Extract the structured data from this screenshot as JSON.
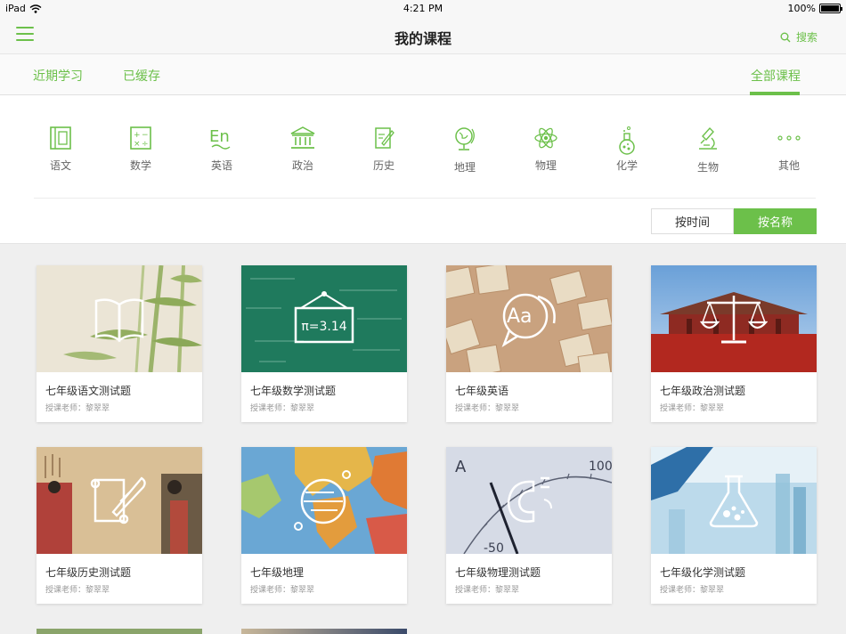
{
  "status": {
    "device": "iPad",
    "time": "4:21 PM",
    "battery": "100%",
    "battery_level": 1.0
  },
  "nav": {
    "title": "我的课程",
    "search_label": "搜索"
  },
  "tabs": {
    "recent": "近期学习",
    "cached": "已缓存",
    "all": "全部课程"
  },
  "subjects": [
    "语文",
    "数学",
    "英语",
    "政治",
    "历史",
    "地理",
    "物理",
    "化学",
    "生物",
    "其他"
  ],
  "sort": {
    "by_time": "按时间",
    "by_name": "按名称"
  },
  "courses": [
    {
      "title": "七年级语文测试题",
      "teacher": "授课老师：黎翠翠",
      "emblem_text": ""
    },
    {
      "title": "七年级数学测试题",
      "teacher": "授课老师：黎翠翠",
      "emblem_text": "π=3.14"
    },
    {
      "title": "七年级英语",
      "teacher": "授课老师：黎翠翠",
      "emblem_text": "Aa"
    },
    {
      "title": "七年级政治测试题",
      "teacher": "授课老师：黎翠翠",
      "emblem_text": ""
    },
    {
      "title": "七年级历史测试题",
      "teacher": "授课老师：黎翠翠",
      "emblem_text": ""
    },
    {
      "title": "七年级地理",
      "teacher": "授课老师：黎翠翠",
      "emblem_text": ""
    },
    {
      "title": "七年级物理测试题",
      "teacher": "授课老师：黎翠翠",
      "emblem_text": ""
    },
    {
      "title": "七年级化学测试题",
      "teacher": "授课老师：黎翠翠",
      "emblem_text": ""
    }
  ],
  "colors": {
    "accent": "#6cc04a",
    "background": "#efefef"
  }
}
